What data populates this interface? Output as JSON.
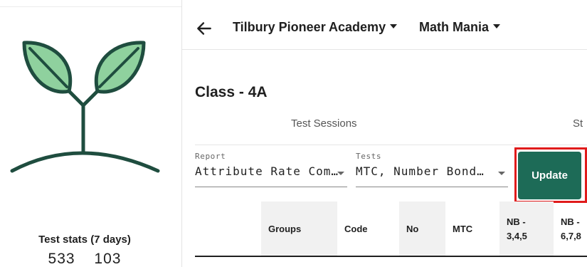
{
  "header": {
    "school": "Tilbury Pioneer Academy",
    "product": "Math Mania"
  },
  "sidebar": {
    "stats_title": "Test stats (7 days)",
    "stat_values": [
      "533",
      "103"
    ]
  },
  "page": {
    "title": "Class - 4A"
  },
  "tabs": [
    {
      "label": "Test Sessions"
    },
    {
      "label": "St"
    }
  ],
  "filters": {
    "report": {
      "label": "Report",
      "value": "Attribute Rate Com…"
    },
    "tests": {
      "label": "Tests",
      "value": "MTC, Number Bond…"
    }
  },
  "update_button": {
    "label": "Update"
  },
  "table": {
    "columns": [
      {
        "label": ""
      },
      {
        "label": "Groups"
      },
      {
        "label": "Code"
      },
      {
        "label": "No"
      },
      {
        "label": "MTC"
      },
      {
        "line1": "NB -",
        "line2": "3,4,5"
      },
      {
        "line1": "NB -",
        "line2": "6,7,8"
      }
    ]
  },
  "colors": {
    "accent": "#1d6b57",
    "highlight": "#e01b1b",
    "leaf_fill": "#8fd19e",
    "plant_stroke": "#1f4d3f"
  },
  "icons": {
    "back": "arrow-left-icon",
    "logo": "sprout-logo"
  }
}
